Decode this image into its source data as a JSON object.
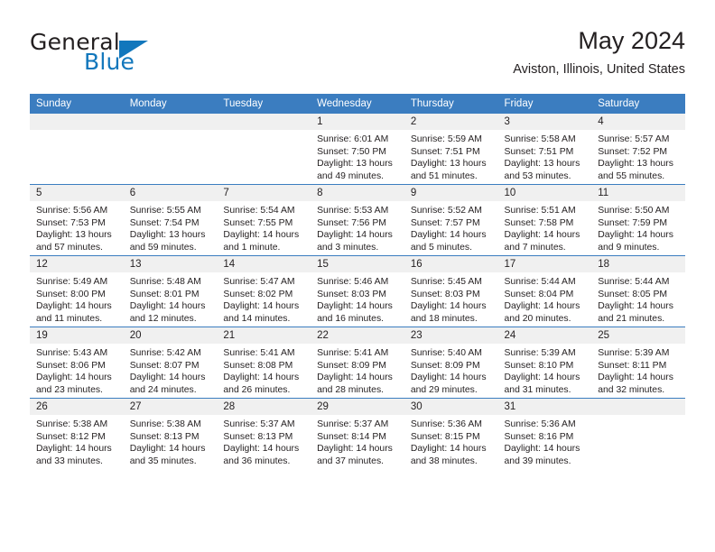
{
  "brand": {
    "word_one": "General",
    "word_two": "Blue",
    "mark": "triangle-logo",
    "accent_color": "#1277bc"
  },
  "header": {
    "title": "May 2024",
    "subtitle": "Aviston, Illinois, United States"
  },
  "calendar": {
    "header_color": "#3b7dc0",
    "daynum_background": "#f0f0f0",
    "weekday_names": [
      "Sunday",
      "Monday",
      "Tuesday",
      "Wednesday",
      "Thursday",
      "Friday",
      "Saturday"
    ],
    "weeks": [
      [
        {
          "day": "",
          "empty": true,
          "sunrise": "",
          "sunset": "",
          "daylight_line1": "",
          "daylight_line2": ""
        },
        {
          "day": "",
          "empty": true,
          "sunrise": "",
          "sunset": "",
          "daylight_line1": "",
          "daylight_line2": ""
        },
        {
          "day": "",
          "empty": true,
          "sunrise": "",
          "sunset": "",
          "daylight_line1": "",
          "daylight_line2": ""
        },
        {
          "day": "1",
          "empty": false,
          "sunrise": "Sunrise: 6:01 AM",
          "sunset": "Sunset: 7:50 PM",
          "daylight_line1": "Daylight: 13 hours",
          "daylight_line2": "and 49 minutes."
        },
        {
          "day": "2",
          "empty": false,
          "sunrise": "Sunrise: 5:59 AM",
          "sunset": "Sunset: 7:51 PM",
          "daylight_line1": "Daylight: 13 hours",
          "daylight_line2": "and 51 minutes."
        },
        {
          "day": "3",
          "empty": false,
          "sunrise": "Sunrise: 5:58 AM",
          "sunset": "Sunset: 7:51 PM",
          "daylight_line1": "Daylight: 13 hours",
          "daylight_line2": "and 53 minutes."
        },
        {
          "day": "4",
          "empty": false,
          "sunrise": "Sunrise: 5:57 AM",
          "sunset": "Sunset: 7:52 PM",
          "daylight_line1": "Daylight: 13 hours",
          "daylight_line2": "and 55 minutes."
        }
      ],
      [
        {
          "day": "5",
          "empty": false,
          "sunrise": "Sunrise: 5:56 AM",
          "sunset": "Sunset: 7:53 PM",
          "daylight_line1": "Daylight: 13 hours",
          "daylight_line2": "and 57 minutes."
        },
        {
          "day": "6",
          "empty": false,
          "sunrise": "Sunrise: 5:55 AM",
          "sunset": "Sunset: 7:54 PM",
          "daylight_line1": "Daylight: 13 hours",
          "daylight_line2": "and 59 minutes."
        },
        {
          "day": "7",
          "empty": false,
          "sunrise": "Sunrise: 5:54 AM",
          "sunset": "Sunset: 7:55 PM",
          "daylight_line1": "Daylight: 14 hours",
          "daylight_line2": "and 1 minute."
        },
        {
          "day": "8",
          "empty": false,
          "sunrise": "Sunrise: 5:53 AM",
          "sunset": "Sunset: 7:56 PM",
          "daylight_line1": "Daylight: 14 hours",
          "daylight_line2": "and 3 minutes."
        },
        {
          "day": "9",
          "empty": false,
          "sunrise": "Sunrise: 5:52 AM",
          "sunset": "Sunset: 7:57 PM",
          "daylight_line1": "Daylight: 14 hours",
          "daylight_line2": "and 5 minutes."
        },
        {
          "day": "10",
          "empty": false,
          "sunrise": "Sunrise: 5:51 AM",
          "sunset": "Sunset: 7:58 PM",
          "daylight_line1": "Daylight: 14 hours",
          "daylight_line2": "and 7 minutes."
        },
        {
          "day": "11",
          "empty": false,
          "sunrise": "Sunrise: 5:50 AM",
          "sunset": "Sunset: 7:59 PM",
          "daylight_line1": "Daylight: 14 hours",
          "daylight_line2": "and 9 minutes."
        }
      ],
      [
        {
          "day": "12",
          "empty": false,
          "sunrise": "Sunrise: 5:49 AM",
          "sunset": "Sunset: 8:00 PM",
          "daylight_line1": "Daylight: 14 hours",
          "daylight_line2": "and 11 minutes."
        },
        {
          "day": "13",
          "empty": false,
          "sunrise": "Sunrise: 5:48 AM",
          "sunset": "Sunset: 8:01 PM",
          "daylight_line1": "Daylight: 14 hours",
          "daylight_line2": "and 12 minutes."
        },
        {
          "day": "14",
          "empty": false,
          "sunrise": "Sunrise: 5:47 AM",
          "sunset": "Sunset: 8:02 PM",
          "daylight_line1": "Daylight: 14 hours",
          "daylight_line2": "and 14 minutes."
        },
        {
          "day": "15",
          "empty": false,
          "sunrise": "Sunrise: 5:46 AM",
          "sunset": "Sunset: 8:03 PM",
          "daylight_line1": "Daylight: 14 hours",
          "daylight_line2": "and 16 minutes."
        },
        {
          "day": "16",
          "empty": false,
          "sunrise": "Sunrise: 5:45 AM",
          "sunset": "Sunset: 8:03 PM",
          "daylight_line1": "Daylight: 14 hours",
          "daylight_line2": "and 18 minutes."
        },
        {
          "day": "17",
          "empty": false,
          "sunrise": "Sunrise: 5:44 AM",
          "sunset": "Sunset: 8:04 PM",
          "daylight_line1": "Daylight: 14 hours",
          "daylight_line2": "and 20 minutes."
        },
        {
          "day": "18",
          "empty": false,
          "sunrise": "Sunrise: 5:44 AM",
          "sunset": "Sunset: 8:05 PM",
          "daylight_line1": "Daylight: 14 hours",
          "daylight_line2": "and 21 minutes."
        }
      ],
      [
        {
          "day": "19",
          "empty": false,
          "sunrise": "Sunrise: 5:43 AM",
          "sunset": "Sunset: 8:06 PM",
          "daylight_line1": "Daylight: 14 hours",
          "daylight_line2": "and 23 minutes."
        },
        {
          "day": "20",
          "empty": false,
          "sunrise": "Sunrise: 5:42 AM",
          "sunset": "Sunset: 8:07 PM",
          "daylight_line1": "Daylight: 14 hours",
          "daylight_line2": "and 24 minutes."
        },
        {
          "day": "21",
          "empty": false,
          "sunrise": "Sunrise: 5:41 AM",
          "sunset": "Sunset: 8:08 PM",
          "daylight_line1": "Daylight: 14 hours",
          "daylight_line2": "and 26 minutes."
        },
        {
          "day": "22",
          "empty": false,
          "sunrise": "Sunrise: 5:41 AM",
          "sunset": "Sunset: 8:09 PM",
          "daylight_line1": "Daylight: 14 hours",
          "daylight_line2": "and 28 minutes."
        },
        {
          "day": "23",
          "empty": false,
          "sunrise": "Sunrise: 5:40 AM",
          "sunset": "Sunset: 8:09 PM",
          "daylight_line1": "Daylight: 14 hours",
          "daylight_line2": "and 29 minutes."
        },
        {
          "day": "24",
          "empty": false,
          "sunrise": "Sunrise: 5:39 AM",
          "sunset": "Sunset: 8:10 PM",
          "daylight_line1": "Daylight: 14 hours",
          "daylight_line2": "and 31 minutes."
        },
        {
          "day": "25",
          "empty": false,
          "sunrise": "Sunrise: 5:39 AM",
          "sunset": "Sunset: 8:11 PM",
          "daylight_line1": "Daylight: 14 hours",
          "daylight_line2": "and 32 minutes."
        }
      ],
      [
        {
          "day": "26",
          "empty": false,
          "sunrise": "Sunrise: 5:38 AM",
          "sunset": "Sunset: 8:12 PM",
          "daylight_line1": "Daylight: 14 hours",
          "daylight_line2": "and 33 minutes."
        },
        {
          "day": "27",
          "empty": false,
          "sunrise": "Sunrise: 5:38 AM",
          "sunset": "Sunset: 8:13 PM",
          "daylight_line1": "Daylight: 14 hours",
          "daylight_line2": "and 35 minutes."
        },
        {
          "day": "28",
          "empty": false,
          "sunrise": "Sunrise: 5:37 AM",
          "sunset": "Sunset: 8:13 PM",
          "daylight_line1": "Daylight: 14 hours",
          "daylight_line2": "and 36 minutes."
        },
        {
          "day": "29",
          "empty": false,
          "sunrise": "Sunrise: 5:37 AM",
          "sunset": "Sunset: 8:14 PM",
          "daylight_line1": "Daylight: 14 hours",
          "daylight_line2": "and 37 minutes."
        },
        {
          "day": "30",
          "empty": false,
          "sunrise": "Sunrise: 5:36 AM",
          "sunset": "Sunset: 8:15 PM",
          "daylight_line1": "Daylight: 14 hours",
          "daylight_line2": "and 38 minutes."
        },
        {
          "day": "31",
          "empty": false,
          "sunrise": "Sunrise: 5:36 AM",
          "sunset": "Sunset: 8:16 PM",
          "daylight_line1": "Daylight: 14 hours",
          "daylight_line2": "and 39 minutes."
        },
        {
          "day": "",
          "empty": true,
          "sunrise": "",
          "sunset": "",
          "daylight_line1": "",
          "daylight_line2": ""
        }
      ]
    ]
  }
}
